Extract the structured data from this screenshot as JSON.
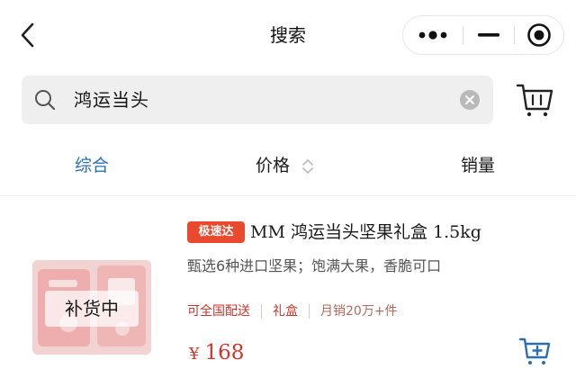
{
  "nav": {
    "title": "搜索",
    "back_icon": "chevron-left-icon",
    "more_icon": "more-dots-icon",
    "minimize_icon": "minimize-icon",
    "close_icon": "target-close-icon"
  },
  "search": {
    "query": "鸿运当头",
    "search_icon": "search-icon",
    "clear_icon": "clear-icon",
    "cart_icon": "cart-icon"
  },
  "sort_tabs": {
    "all": "综合",
    "price": "价格",
    "sales": "销量",
    "active": "综合"
  },
  "product": {
    "badge": "极速达",
    "title": "MM 鸿运当头坚果礼盒 1.5kg",
    "description": "甄选6种进口坚果；饱满大果，香脆可口",
    "tags": [
      "可全国配送",
      "礼盒",
      "月销20万+件"
    ],
    "image_overlay": "补货中",
    "currency": "¥",
    "price": "168",
    "add_icon": "add-to-cart-icon"
  },
  "colors": {
    "accent_blue": "#2b6fb0",
    "price_red": "#d2352d",
    "badge_red": "#e8492f"
  }
}
